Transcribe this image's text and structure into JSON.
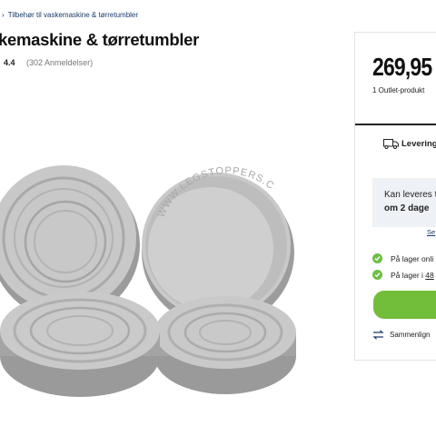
{
  "breadcrumb": {
    "current": "Tilbehør til vaskemaskine & tørretumbler"
  },
  "product": {
    "title": "kemaskine & tørretumbler",
    "rating": "4.4",
    "reviews": "(302 Anmeldelser)",
    "image_watermark": "WWW.LEGSTOPPERS.COM"
  },
  "buybox": {
    "price": "269,95",
    "outlet": "1 Outlet-produkt",
    "delivery_label": "Levering",
    "delivery_box": {
      "line1": "Kan leveres t",
      "line2": "om 2 dage"
    },
    "see_link": "Se",
    "stock_online": "På lager onli",
    "stock_store_prefix": "På lager i",
    "stock_store_count": "48",
    "compare_label": "Sammenlign"
  },
  "colors": {
    "accent_green": "#72bd3a",
    "check_green": "#6fbe44",
    "link_blue": "#1a3a6b"
  }
}
